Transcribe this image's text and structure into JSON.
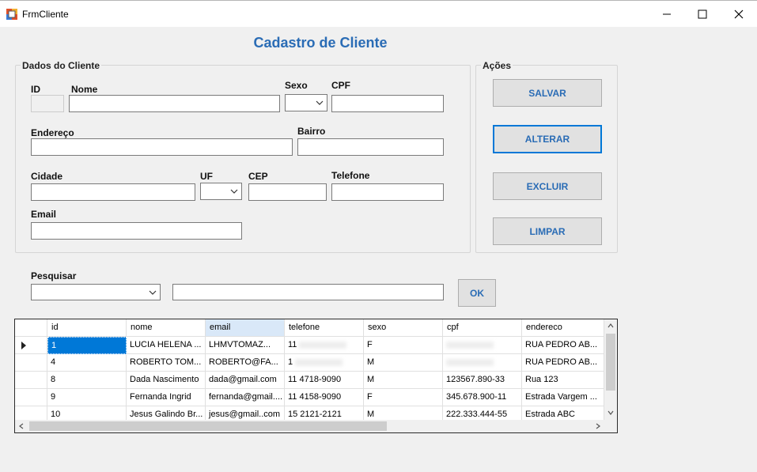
{
  "window": {
    "title": "FrmCliente"
  },
  "form": {
    "title": "Cadastro de Cliente"
  },
  "dados": {
    "legend": "Dados do Cliente",
    "labels": {
      "id": "ID",
      "nome": "Nome",
      "sexo": "Sexo",
      "cpf": "CPF",
      "endereco": "Endereço",
      "bairro": "Bairro",
      "cidade": "Cidade",
      "uf": "UF",
      "cep": "CEP",
      "telefone": "Telefone",
      "email": "Email"
    }
  },
  "acoes": {
    "legend": "Ações",
    "salvar": "SALVAR",
    "alterar": "ALTERAR",
    "excluir": "EXCLUIR",
    "limpar": "LIMPAR"
  },
  "pesquisar": {
    "label": "Pesquisar",
    "ok": "OK"
  },
  "grid": {
    "columns": [
      "id",
      "nome",
      "email",
      "telefone",
      "sexo",
      "cpf",
      "endereco"
    ],
    "rows": [
      [
        "1",
        "LUCIA HELENA ...",
        "LHMVTOMAZ...",
        "11",
        "F",
        "",
        "RUA PEDRO AB..."
      ],
      [
        "4",
        "ROBERTO TOM...",
        "ROBERTO@FA...",
        "1",
        "M",
        "",
        "RUA PEDRO AB..."
      ],
      [
        "8",
        "Dada Nascimento",
        "dada@gmail.com",
        "11 4718-9090",
        "M",
        "123567.890-33",
        "Rua 123"
      ],
      [
        "9",
        "Fernanda Ingrid",
        "fernanda@gmail....",
        "11 4158-9090",
        "F",
        "345.678.900-11",
        "Estrada Vargem ..."
      ],
      [
        "10",
        "Jesus Galindo Br...",
        "jesus@gmail..com",
        "15 2121-2121",
        "M",
        "222.333.444-55",
        "Estrada ABC"
      ]
    ]
  },
  "colors": {
    "accent": "#2a6cb5",
    "selection": "#0078d7"
  }
}
